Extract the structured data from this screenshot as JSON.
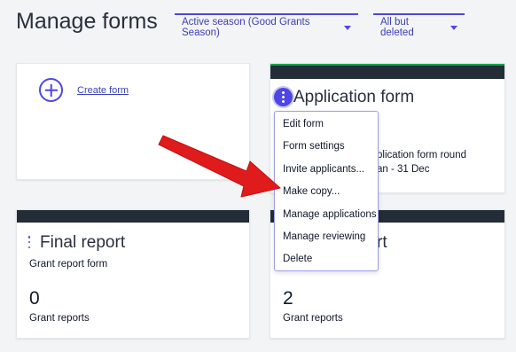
{
  "page": {
    "title": "Manage forms"
  },
  "filters": {
    "season": "Active season (Good Grants Season)",
    "status": "All but deleted"
  },
  "cards": {
    "create": {
      "label": "Create form"
    },
    "application": {
      "title": "Application form",
      "sub_partial": "plication form round",
      "dates_partial": "an - 31 Dec"
    },
    "final_report": {
      "title": "Final report",
      "subtitle": "Grant report form",
      "count": "0",
      "count_label": "Grant reports"
    },
    "fourth": {
      "title_partial": "rt",
      "count": "2",
      "count_label": "Grant reports"
    }
  },
  "menu": {
    "items": [
      "Edit form",
      "Form settings",
      "Invite applicants...",
      "Make copy...",
      "Manage applications",
      "Manage reviewing",
      "Delete"
    ]
  },
  "colors": {
    "accent": "#4f46e5",
    "header_dark": "#232c37",
    "active_stripe": "#16a34a",
    "annotation_arrow": "#e01b1b"
  },
  "icons": {
    "create": "plus-circle-icon",
    "card_menu": "kebab-menu-icon",
    "filter_caret": "chevron-down-icon",
    "annotation": "arrow-annotation"
  }
}
